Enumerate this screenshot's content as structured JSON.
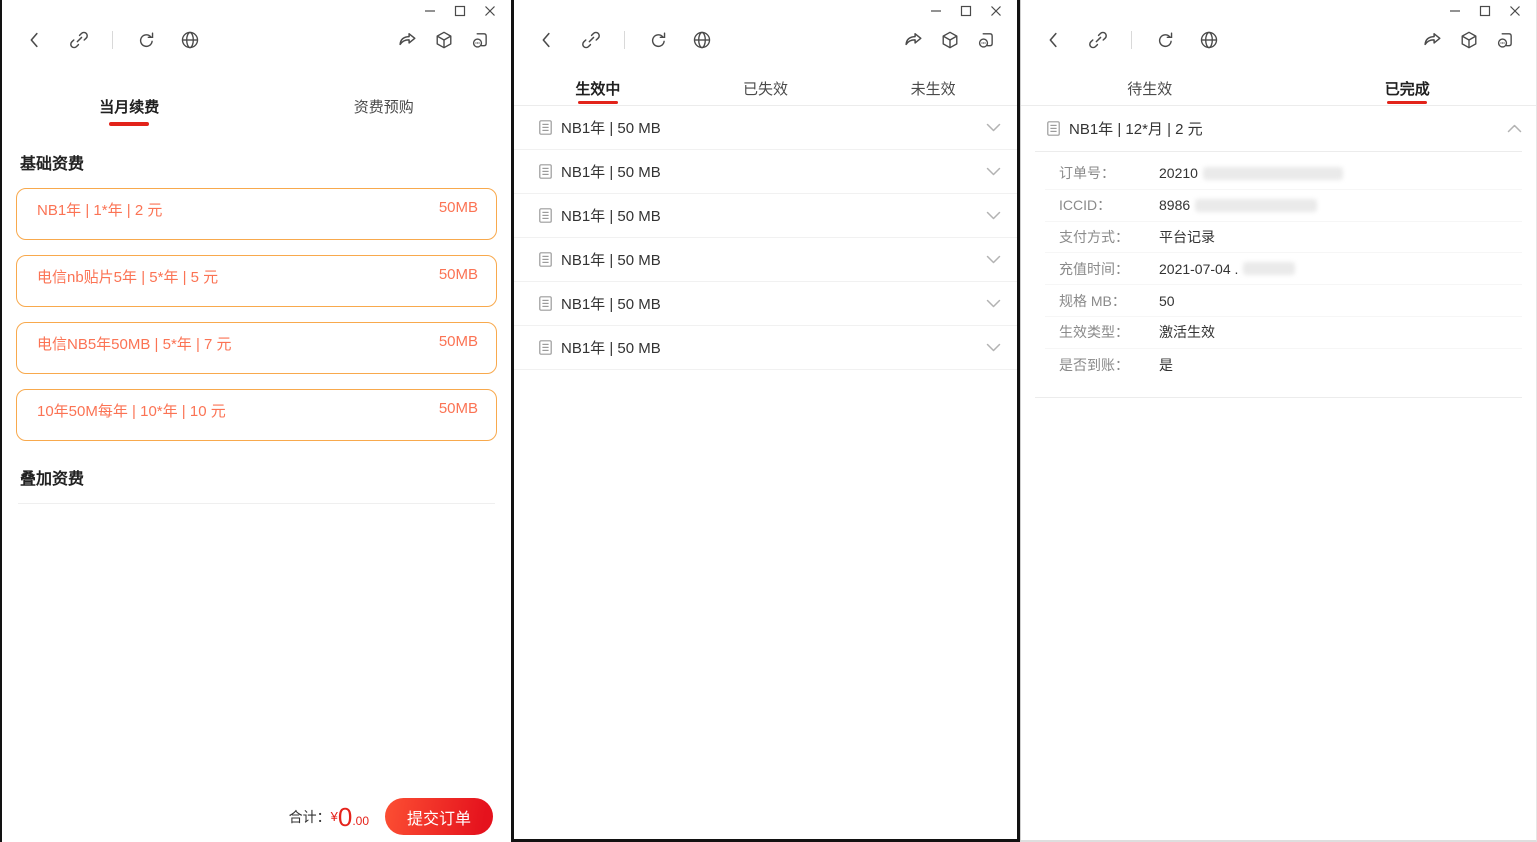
{
  "colors": {
    "accent_red": "#e2231a",
    "card_border_orange": "#f8a94d",
    "card_text_coral": "#fb7354",
    "button_gradient": [
      "#fc4f33",
      "#e5121d"
    ],
    "icon_gray": "#4a4a4a"
  },
  "icons": {
    "titlebar": [
      "minimize-icon",
      "maximize-icon",
      "close-icon"
    ],
    "toolbar_left": [
      "back-icon",
      "link-icon",
      "refresh-icon",
      "globe-icon"
    ],
    "toolbar_right": [
      "share-icon",
      "cube-icon",
      "floating-window-icon"
    ],
    "list": [
      "document-icon",
      "chevron-down-icon",
      "chevron-up-icon"
    ]
  },
  "w1": {
    "tabs": [
      {
        "label": "当月续费"
      },
      {
        "label": "资费预购"
      }
    ],
    "base_section_title": "基础资费",
    "overlay_section_title": "叠加资费",
    "plans": [
      {
        "name": "NB1年 | 1*年 | 2 元",
        "size": "50MB"
      },
      {
        "name": "电信nb贴片5年 | 5*年 | 5 元",
        "size": "50MB"
      },
      {
        "name": "电信NB5年50MB | 5*年 | 7 元",
        "size": "50MB"
      },
      {
        "name": "10年50M每年 | 10*年 | 10 元",
        "size": "50MB"
      }
    ],
    "footer": {
      "total_label": "合计：",
      "currency": "¥",
      "amount_integer": "0",
      "amount_decimals": ".00",
      "submit_label": "提交订单"
    }
  },
  "w2": {
    "tabs": [
      {
        "label": "生效中"
      },
      {
        "label": "已失效"
      },
      {
        "label": "未生效"
      }
    ],
    "items": [
      {
        "title": "NB1年 | 50 MB"
      },
      {
        "title": "NB1年 | 50 MB"
      },
      {
        "title": "NB1年 | 50 MB"
      },
      {
        "title": "NB1年 | 50 MB"
      },
      {
        "title": "NB1年 | 50 MB"
      },
      {
        "title": "NB1年 | 50 MB"
      }
    ]
  },
  "w3": {
    "tabs": [
      {
        "label": "待生效"
      },
      {
        "label": "已完成"
      }
    ],
    "order": {
      "title": "NB1年 | 12*月 | 2 元",
      "details": [
        {
          "label": "订单号：",
          "value": "20210"
        },
        {
          "label": "ICCID：",
          "value": "8986"
        },
        {
          "label": "支付方式：",
          "value": "平台记录"
        },
        {
          "label": "充值时间：",
          "value": "2021-07-04 ."
        },
        {
          "label": "规格 MB：",
          "value": "50"
        },
        {
          "label": "生效类型：",
          "value": "激活生效"
        },
        {
          "label": "是否到账：",
          "value": "是"
        }
      ]
    }
  }
}
